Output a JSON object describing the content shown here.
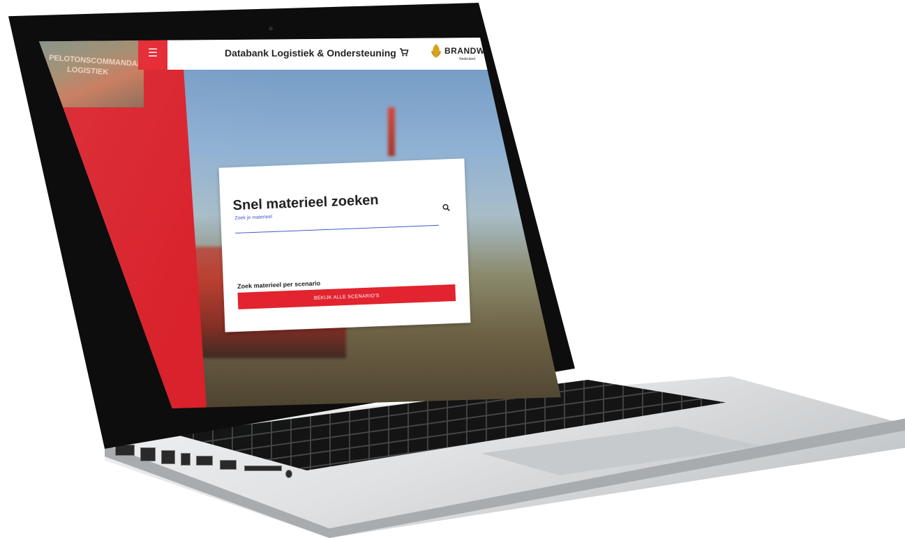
{
  "sidebar": {
    "photo_text_line1": "PELOTONSCOMMANDANT",
    "photo_text_line2": "LOGISTIEK",
    "menu_icon": "hamburger-menu-icon"
  },
  "header": {
    "title": "Databank Logistiek & Ondersteuning",
    "cart_icon": "shopping-cart-icon",
    "logo_text": "BRANDWEER",
    "logo_subtext": "Nederland"
  },
  "search_card": {
    "title": "Snel materieel zoeken",
    "input_label": "Zoek je materieel",
    "input_value": "",
    "search_icon": "search-icon",
    "scenario_label": "Zoek materieel per scenario",
    "scenario_button": "Bekijk alle scenario's"
  },
  "colors": {
    "brand_red": "#d9222c",
    "button_red": "#e1242f",
    "input_accent": "#3f5ac9"
  }
}
